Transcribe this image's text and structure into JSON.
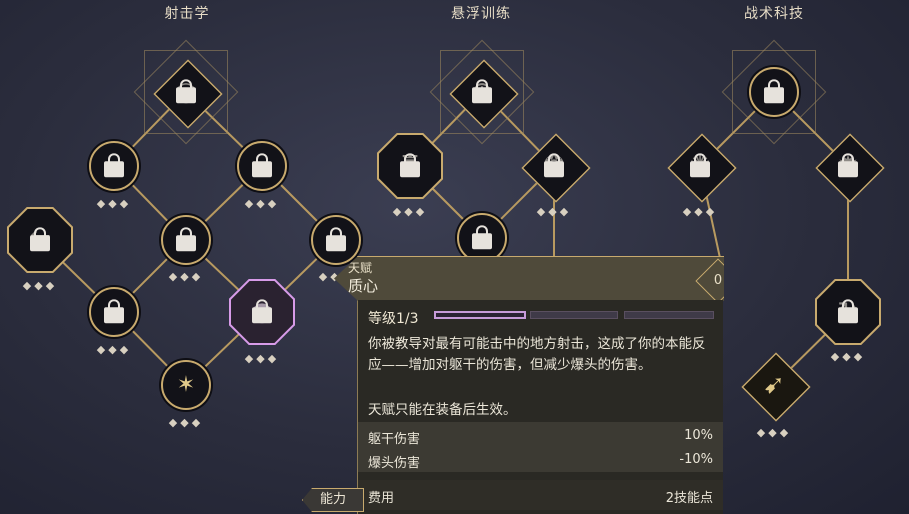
{
  "columns": [
    {
      "title": "射击学"
    },
    {
      "title": "悬浮训练"
    },
    {
      "title": "战术科技"
    }
  ],
  "node_dots": "◆◆◆",
  "tooltip": {
    "category": "天赋",
    "name": "质心",
    "cost_badge": "0",
    "level_label": "等级1/3",
    "level_current": 1,
    "level_max": 3,
    "description": "你被教导对最有可能击中的地方射击，这成了你的本能反应——增加对躯干的伤害，但减少爆头的伤害。",
    "note": "天赋只能在装备后生效。",
    "stats": [
      {
        "label": "躯干伤害",
        "value": "10%"
      },
      {
        "label": "爆头伤害",
        "value": "-10%"
      }
    ],
    "cost_label": "费用",
    "cost_value": "2技能点"
  },
  "ability_tab": "能力",
  "colors": {
    "accent": "#c8aa6e",
    "selected": "#d79be8",
    "panel": "#2a2924"
  }
}
